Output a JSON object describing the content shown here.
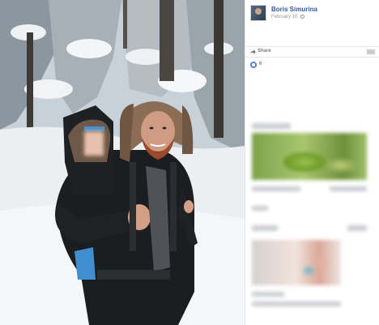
{
  "post": {
    "author": "Boris Simurina",
    "date": "February 10",
    "privacy_icon": "globe-icon"
  },
  "actions": {
    "share_label": "Share",
    "share_icon": "share-arrow-icon"
  },
  "reactions": {
    "icon": "like-icon",
    "count": "6"
  },
  "colors": {
    "link_blue": "#365899",
    "meta_gray": "#90949c",
    "like_blue": "#4a7de2"
  }
}
